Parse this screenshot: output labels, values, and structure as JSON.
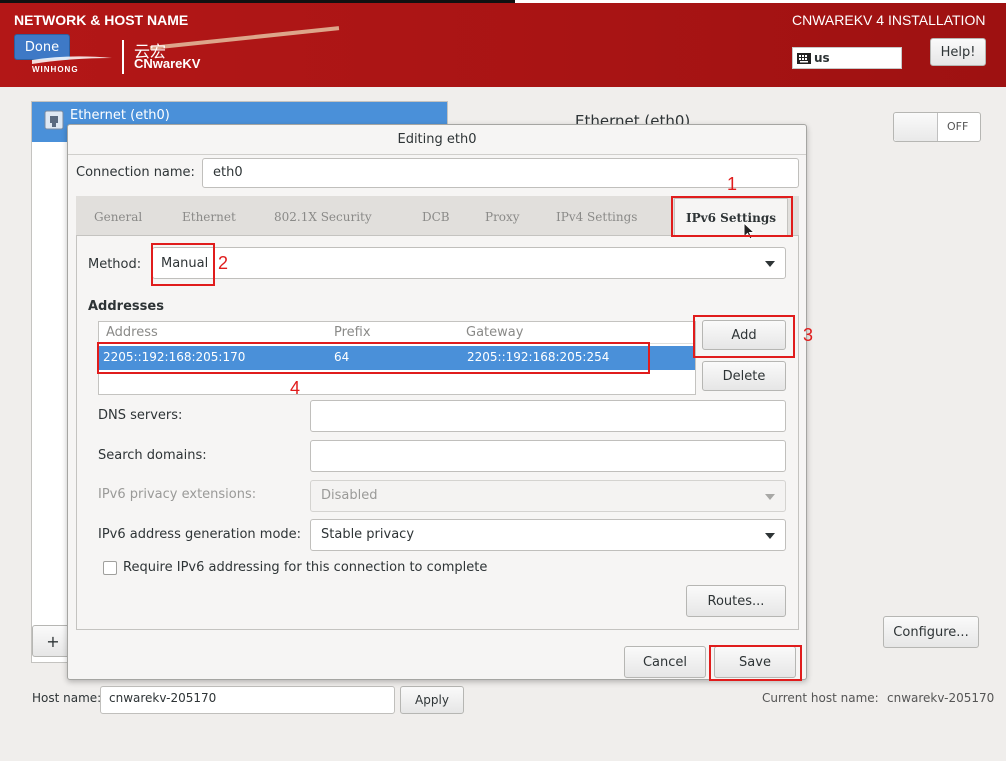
{
  "header": {
    "page_title": "NETWORK & HOST NAME",
    "done_label": "Done",
    "logo_cn": "云宏",
    "logo_en": "CNwareKV",
    "logo_small": "WINHONG",
    "install_title": "CNWAREKV 4 INSTALLATION",
    "keyboard": "us",
    "help_label": "Help!"
  },
  "background": {
    "list_item": "Ethernet (eth0)",
    "detail_title": "Ethernet (eth0)",
    "toggle_label": "OFF",
    "add_label": "+",
    "configure_label": "Configure..."
  },
  "hostname": {
    "label": "Host name:",
    "value": "cnwarekv-205170",
    "apply_label": "Apply",
    "current_label": "Current host name:",
    "current_value": "cnwarekv-205170"
  },
  "dialog": {
    "title": "Editing eth0",
    "connection_label": "Connection name:",
    "connection_value": "eth0",
    "tabs": [
      "General",
      "Ethernet",
      "802.1X Security",
      "DCB",
      "Proxy",
      "IPv4 Settings",
      "IPv6 Settings"
    ],
    "method_label": "Method:",
    "method_value": "Manual",
    "addresses_heading": "Addresses",
    "columns": [
      "Address",
      "Prefix",
      "Gateway"
    ],
    "rows": [
      {
        "address": "2205::192:168:205:170",
        "prefix": "64",
        "gateway": "2205::192:168:205:254"
      }
    ],
    "add_label": "Add",
    "delete_label": "Delete",
    "dns_label": "DNS servers:",
    "dns_value": "",
    "search_label": "Search domains:",
    "search_value": "",
    "privacy_label": "IPv6 privacy extensions:",
    "privacy_value": "Disabled",
    "genmode_label": "IPv6 address generation mode:",
    "genmode_value": "Stable privacy",
    "require_label": "Require IPv6 addressing for this connection to complete",
    "routes_label": "Routes...",
    "cancel_label": "Cancel",
    "save_label": "Save"
  },
  "annotations": [
    "1",
    "2",
    "3",
    "4"
  ],
  "colors": {
    "header_red": "#a81414",
    "selection_blue": "#4a90d9",
    "annotation_red": "#e01c1c"
  }
}
